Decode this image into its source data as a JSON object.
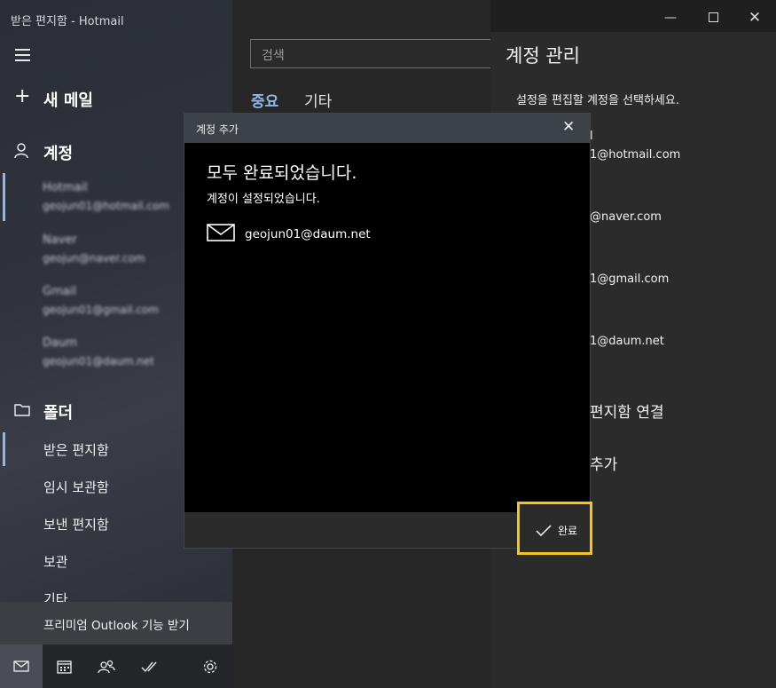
{
  "window": {
    "title": "받은 편지함 - Hotmail"
  },
  "sidebar": {
    "new_mail": "새 메일",
    "accounts_heading": "계정",
    "accounts": [
      {
        "name": "Hotmail",
        "email": "geojun01@hotmail.com"
      },
      {
        "name": "Naver",
        "email": "geojun@naver.com"
      },
      {
        "name": "Gmail",
        "email": "geojun01@gmail.com"
      },
      {
        "name": "Daum",
        "email": "geojun01@daum.net"
      }
    ],
    "folders_heading": "폴더",
    "folders": [
      "받은 편지함",
      "임시 보관함",
      "보낸 편지함",
      "보관",
      "기타"
    ],
    "promo": "프리미엄 Outlook 기능 받기"
  },
  "middle": {
    "search_placeholder": "검색",
    "tab_focused": "중요",
    "tab_other": "기타"
  },
  "manage": {
    "title": "계정 관리",
    "instruction": "설정을 편집할 계정을 선택하세요.",
    "name_partial": "l",
    "emails": [
      "1@hotmail.com",
      "@naver.com",
      "1@gmail.com",
      "1@daum.net"
    ],
    "link_inbox": "편지함 연결",
    "add_account": "추가"
  },
  "dialog": {
    "title": "계정 추가",
    "heading": "모두 완료되었습니다.",
    "subheading": "계정이 설정되었습니다.",
    "account_email": "geojun01@daum.net",
    "done_label": "완료"
  },
  "colors": {
    "accent": "#8fb7e8",
    "highlight_border": "#f5c518"
  }
}
